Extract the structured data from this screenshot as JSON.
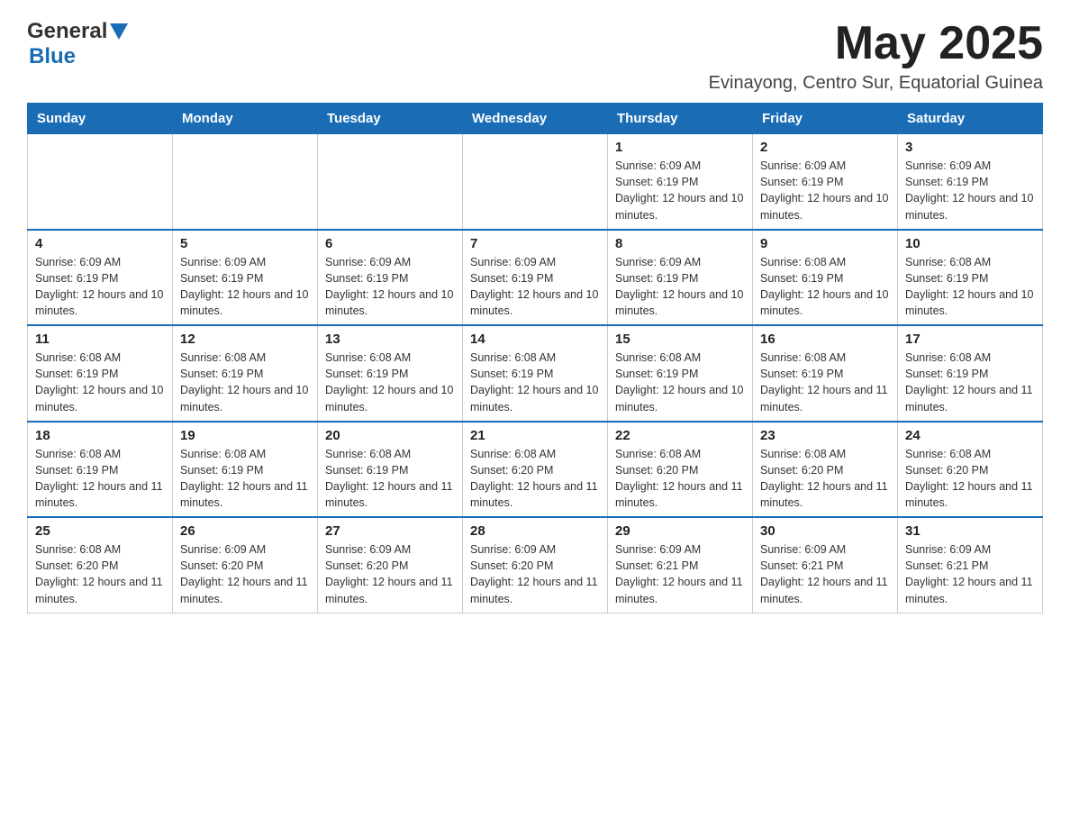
{
  "header": {
    "logo_general": "General",
    "logo_blue": "Blue",
    "month_title": "May 2025",
    "location": "Evinayong, Centro Sur, Equatorial Guinea"
  },
  "days_of_week": [
    "Sunday",
    "Monday",
    "Tuesday",
    "Wednesday",
    "Thursday",
    "Friday",
    "Saturday"
  ],
  "weeks": [
    [
      {
        "day": "",
        "info": ""
      },
      {
        "day": "",
        "info": ""
      },
      {
        "day": "",
        "info": ""
      },
      {
        "day": "",
        "info": ""
      },
      {
        "day": "1",
        "info": "Sunrise: 6:09 AM\nSunset: 6:19 PM\nDaylight: 12 hours and 10 minutes."
      },
      {
        "day": "2",
        "info": "Sunrise: 6:09 AM\nSunset: 6:19 PM\nDaylight: 12 hours and 10 minutes."
      },
      {
        "day": "3",
        "info": "Sunrise: 6:09 AM\nSunset: 6:19 PM\nDaylight: 12 hours and 10 minutes."
      }
    ],
    [
      {
        "day": "4",
        "info": "Sunrise: 6:09 AM\nSunset: 6:19 PM\nDaylight: 12 hours and 10 minutes."
      },
      {
        "day": "5",
        "info": "Sunrise: 6:09 AM\nSunset: 6:19 PM\nDaylight: 12 hours and 10 minutes."
      },
      {
        "day": "6",
        "info": "Sunrise: 6:09 AM\nSunset: 6:19 PM\nDaylight: 12 hours and 10 minutes."
      },
      {
        "day": "7",
        "info": "Sunrise: 6:09 AM\nSunset: 6:19 PM\nDaylight: 12 hours and 10 minutes."
      },
      {
        "day": "8",
        "info": "Sunrise: 6:09 AM\nSunset: 6:19 PM\nDaylight: 12 hours and 10 minutes."
      },
      {
        "day": "9",
        "info": "Sunrise: 6:08 AM\nSunset: 6:19 PM\nDaylight: 12 hours and 10 minutes."
      },
      {
        "day": "10",
        "info": "Sunrise: 6:08 AM\nSunset: 6:19 PM\nDaylight: 12 hours and 10 minutes."
      }
    ],
    [
      {
        "day": "11",
        "info": "Sunrise: 6:08 AM\nSunset: 6:19 PM\nDaylight: 12 hours and 10 minutes."
      },
      {
        "day": "12",
        "info": "Sunrise: 6:08 AM\nSunset: 6:19 PM\nDaylight: 12 hours and 10 minutes."
      },
      {
        "day": "13",
        "info": "Sunrise: 6:08 AM\nSunset: 6:19 PM\nDaylight: 12 hours and 10 minutes."
      },
      {
        "day": "14",
        "info": "Sunrise: 6:08 AM\nSunset: 6:19 PM\nDaylight: 12 hours and 10 minutes."
      },
      {
        "day": "15",
        "info": "Sunrise: 6:08 AM\nSunset: 6:19 PM\nDaylight: 12 hours and 10 minutes."
      },
      {
        "day": "16",
        "info": "Sunrise: 6:08 AM\nSunset: 6:19 PM\nDaylight: 12 hours and 11 minutes."
      },
      {
        "day": "17",
        "info": "Sunrise: 6:08 AM\nSunset: 6:19 PM\nDaylight: 12 hours and 11 minutes."
      }
    ],
    [
      {
        "day": "18",
        "info": "Sunrise: 6:08 AM\nSunset: 6:19 PM\nDaylight: 12 hours and 11 minutes."
      },
      {
        "day": "19",
        "info": "Sunrise: 6:08 AM\nSunset: 6:19 PM\nDaylight: 12 hours and 11 minutes."
      },
      {
        "day": "20",
        "info": "Sunrise: 6:08 AM\nSunset: 6:19 PM\nDaylight: 12 hours and 11 minutes."
      },
      {
        "day": "21",
        "info": "Sunrise: 6:08 AM\nSunset: 6:20 PM\nDaylight: 12 hours and 11 minutes."
      },
      {
        "day": "22",
        "info": "Sunrise: 6:08 AM\nSunset: 6:20 PM\nDaylight: 12 hours and 11 minutes."
      },
      {
        "day": "23",
        "info": "Sunrise: 6:08 AM\nSunset: 6:20 PM\nDaylight: 12 hours and 11 minutes."
      },
      {
        "day": "24",
        "info": "Sunrise: 6:08 AM\nSunset: 6:20 PM\nDaylight: 12 hours and 11 minutes."
      }
    ],
    [
      {
        "day": "25",
        "info": "Sunrise: 6:08 AM\nSunset: 6:20 PM\nDaylight: 12 hours and 11 minutes."
      },
      {
        "day": "26",
        "info": "Sunrise: 6:09 AM\nSunset: 6:20 PM\nDaylight: 12 hours and 11 minutes."
      },
      {
        "day": "27",
        "info": "Sunrise: 6:09 AM\nSunset: 6:20 PM\nDaylight: 12 hours and 11 minutes."
      },
      {
        "day": "28",
        "info": "Sunrise: 6:09 AM\nSunset: 6:20 PM\nDaylight: 12 hours and 11 minutes."
      },
      {
        "day": "29",
        "info": "Sunrise: 6:09 AM\nSunset: 6:21 PM\nDaylight: 12 hours and 11 minutes."
      },
      {
        "day": "30",
        "info": "Sunrise: 6:09 AM\nSunset: 6:21 PM\nDaylight: 12 hours and 11 minutes."
      },
      {
        "day": "31",
        "info": "Sunrise: 6:09 AM\nSunset: 6:21 PM\nDaylight: 12 hours and 11 minutes."
      }
    ]
  ]
}
